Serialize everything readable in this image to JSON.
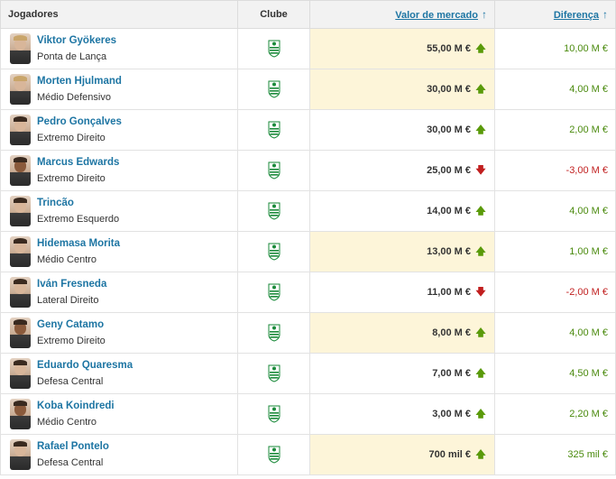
{
  "header": {
    "player": "Jogadores",
    "club": "Clube",
    "market_value": "Valor de mercado",
    "difference": "Diferença",
    "sort_icon": "sort-arrow-up-icon",
    "sort_glyph": "↑"
  },
  "colors": {
    "link": "#1d75a3",
    "highlight": "#fdf5d9",
    "up": "#5a9a0a",
    "down": "#c11f1f"
  },
  "club_icon": "sporting-crest-icon",
  "players": [
    {
      "name": "Viktor Gyökeres",
      "position": "Ponta de Lança",
      "value": "55,00 M €",
      "trend": "up",
      "diff": "10,00 M €",
      "diff_sign": "pos",
      "highlight": true
    },
    {
      "name": "Morten Hjulmand",
      "position": "Médio Defensivo",
      "value": "30,00 M €",
      "trend": "up",
      "diff": "4,00 M €",
      "diff_sign": "pos",
      "highlight": true
    },
    {
      "name": "Pedro Gonçalves",
      "position": "Extremo Direito",
      "value": "30,00 M €",
      "trend": "up",
      "diff": "2,00 M €",
      "diff_sign": "pos",
      "highlight": false
    },
    {
      "name": "Marcus Edwards",
      "position": "Extremo Direito",
      "value": "25,00 M €",
      "trend": "down",
      "diff": "-3,00 M €",
      "diff_sign": "neg",
      "highlight": false
    },
    {
      "name": "Trincão",
      "position": "Extremo Esquerdo",
      "value": "14,00 M €",
      "trend": "up",
      "diff": "4,00 M €",
      "diff_sign": "pos",
      "highlight": false
    },
    {
      "name": "Hidemasa Morita",
      "position": "Médio Centro",
      "value": "13,00 M €",
      "trend": "up",
      "diff": "1,00 M €",
      "diff_sign": "pos",
      "highlight": true
    },
    {
      "name": "Iván Fresneda",
      "position": "Lateral Direito",
      "value": "11,00 M €",
      "trend": "down",
      "diff": "-2,00 M €",
      "diff_sign": "neg",
      "highlight": false
    },
    {
      "name": "Geny Catamo",
      "position": "Extremo Direito",
      "value": "8,00 M €",
      "trend": "up",
      "diff": "4,00 M €",
      "diff_sign": "pos",
      "highlight": true
    },
    {
      "name": "Eduardo Quaresma",
      "position": "Defesa Central",
      "value": "7,00 M €",
      "trend": "up",
      "diff": "4,50 M €",
      "diff_sign": "pos",
      "highlight": false
    },
    {
      "name": "Koba Koindredi",
      "position": "Médio Centro",
      "value": "3,00 M €",
      "trend": "up",
      "diff": "2,20 M €",
      "diff_sign": "pos",
      "highlight": false
    },
    {
      "name": "Rafael Pontelo",
      "position": "Defesa Central",
      "value": "700 mil €",
      "trend": "up",
      "diff": "325 mil €",
      "diff_sign": "pos",
      "highlight": true
    }
  ]
}
